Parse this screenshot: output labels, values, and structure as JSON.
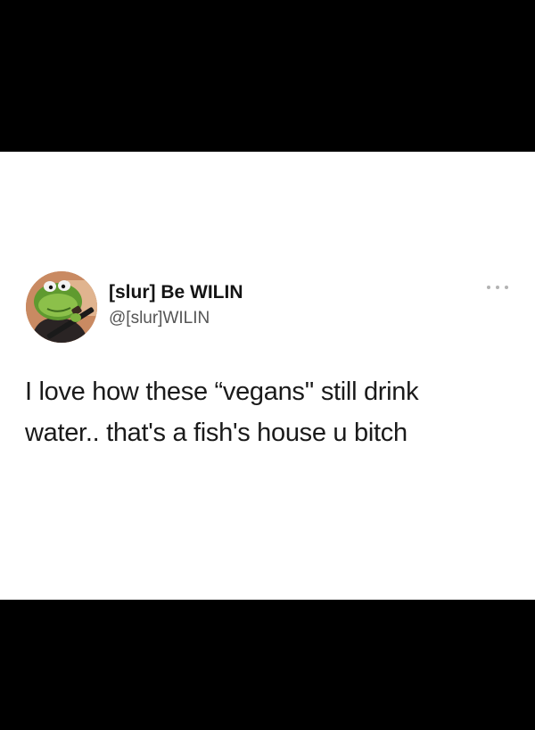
{
  "tweet": {
    "author": {
      "display_name": "[slur] Be WILIN",
      "handle": "@[slur]WILIN",
      "avatar_icon": "frog-with-rifle-avatar"
    },
    "more_icon": "ellipsis-icon",
    "text_lines": [
      "I love how these “vegans'' still drink",
      "water.. that's a fish's house u bitch"
    ]
  },
  "colors": {
    "letterbox": "#000000",
    "card_background": "#ffffff",
    "display_name": "#141414",
    "handle": "#555555",
    "body_text": "#1a1a1a"
  }
}
